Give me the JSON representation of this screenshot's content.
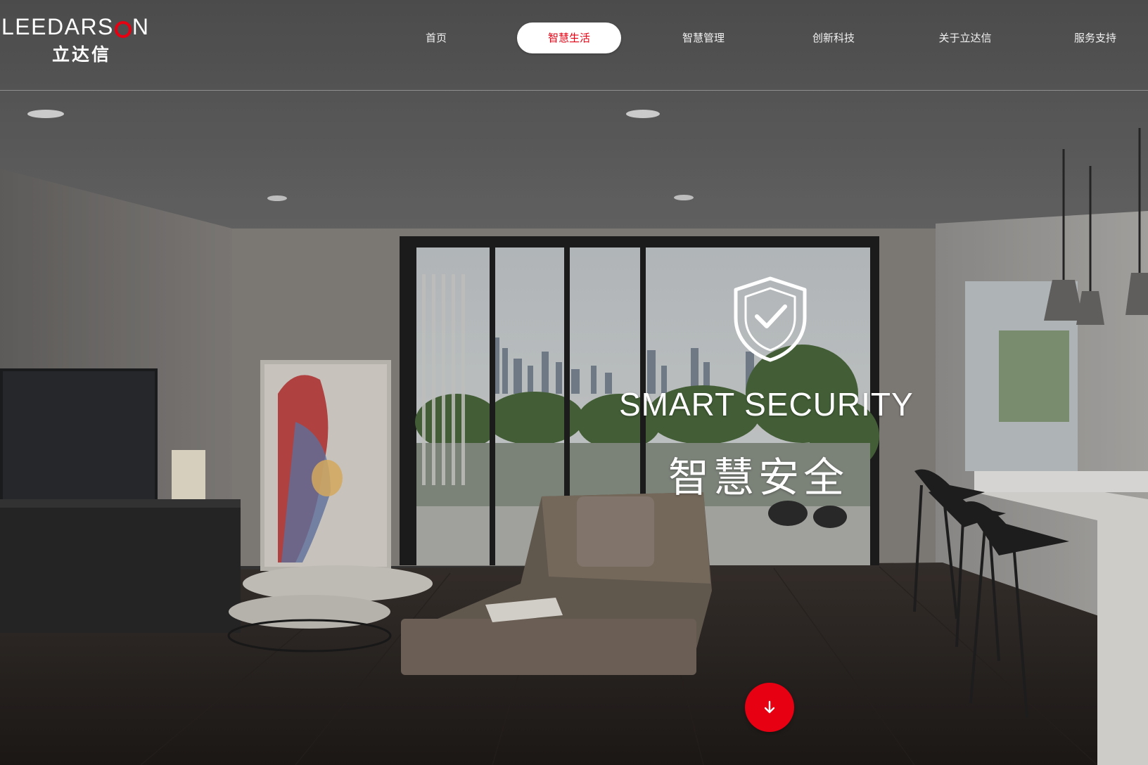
{
  "brand": {
    "name_en_part1": "LEEDARS",
    "name_en_ring": "O",
    "name_en_part2": "N",
    "name_cn": "立达信",
    "accent_color": "#e60012"
  },
  "nav": {
    "items": [
      {
        "label": "首页"
      },
      {
        "label": "智慧生活",
        "active": true
      },
      {
        "label": "智慧管理"
      },
      {
        "label": "创新科技"
      },
      {
        "label": "关于立达信"
      },
      {
        "label": "服务支持"
      }
    ]
  },
  "hero": {
    "icon": "shield-check-icon",
    "title_en": "SMART SECURITY",
    "title_cn": "智慧安全"
  },
  "scroll_button": {
    "icon": "arrow-down-icon"
  }
}
